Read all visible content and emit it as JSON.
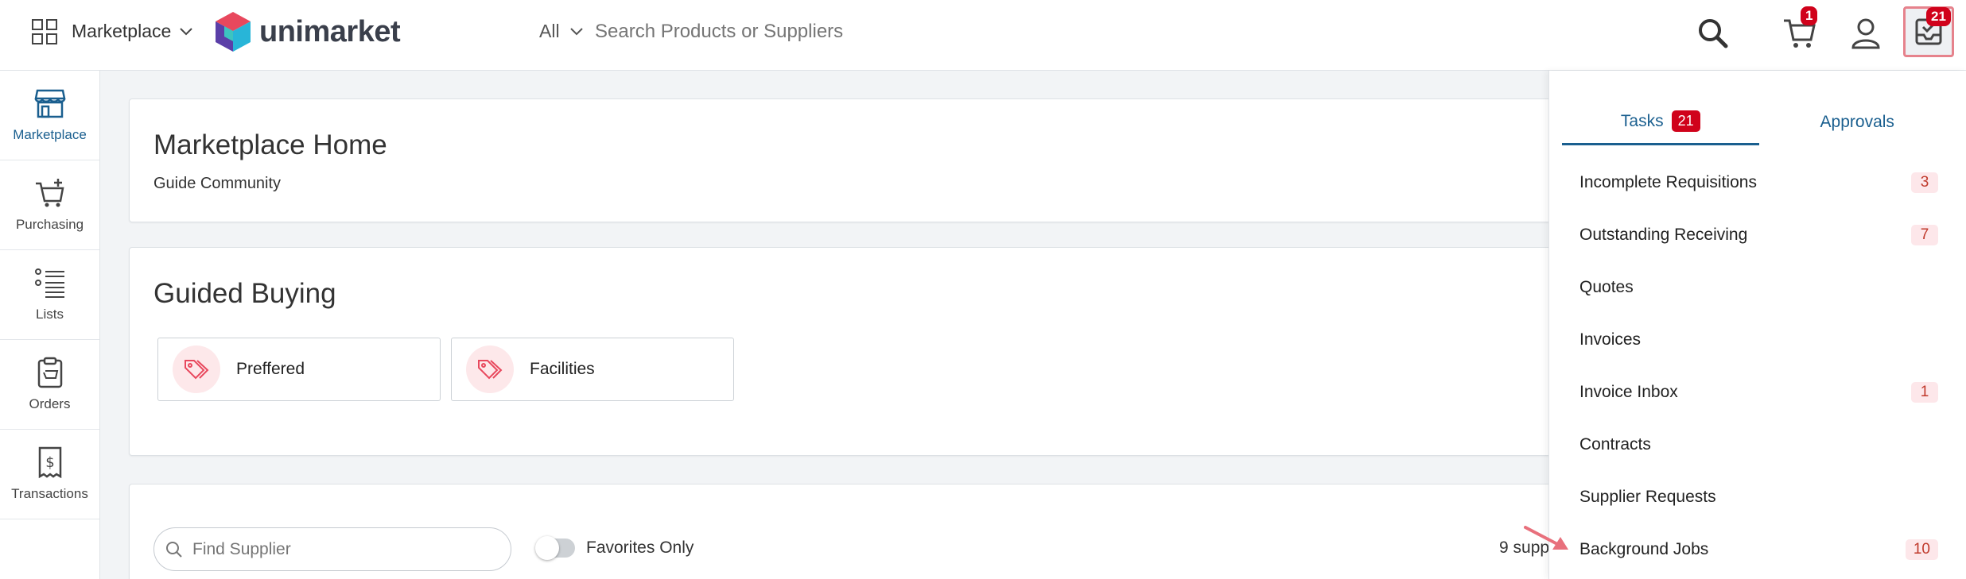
{
  "header": {
    "marketplace_switch": "Marketplace",
    "logo_text": "unimarket",
    "search_scope": "All",
    "search_placeholder": "Search Products or Suppliers",
    "cart_count": "1",
    "tasks_count": "21"
  },
  "sidebar": {
    "items": [
      {
        "label": "Marketplace",
        "icon": "storefront-icon"
      },
      {
        "label": "Purchasing",
        "icon": "cart-plus-icon"
      },
      {
        "label": "Lists",
        "icon": "list-icon"
      },
      {
        "label": "Orders",
        "icon": "clipboard-icon"
      },
      {
        "label": "Transactions",
        "icon": "receipt-dollar-icon"
      }
    ]
  },
  "main": {
    "home_title": "Marketplace Home",
    "home_subtitle": "Guide Community",
    "guided_title": "Guided Buying",
    "guided_tiles": [
      "Preffered",
      "Facilities"
    ],
    "find_placeholder": "Find Supplier",
    "favorites_label": "Favorites Only",
    "supplier_count_text": "9 supp"
  },
  "panel": {
    "tabs": [
      {
        "label": "Tasks",
        "count": "21"
      },
      {
        "label": "Approvals"
      }
    ],
    "tasks": [
      {
        "label": "Incomplete Requisitions",
        "count": "3"
      },
      {
        "label": "Outstanding Receiving",
        "count": "7"
      },
      {
        "label": "Quotes",
        "count": ""
      },
      {
        "label": "Invoices",
        "count": ""
      },
      {
        "label": "Invoice Inbox",
        "count": "1"
      },
      {
        "label": "Contracts",
        "count": ""
      },
      {
        "label": "Supplier Requests",
        "count": ""
      },
      {
        "label": "Background Jobs",
        "count": "10"
      }
    ]
  },
  "colors": {
    "accent_blue": "#1a5f8f",
    "badge_red": "#d0021b",
    "highlight_pink": "#e6828c"
  }
}
